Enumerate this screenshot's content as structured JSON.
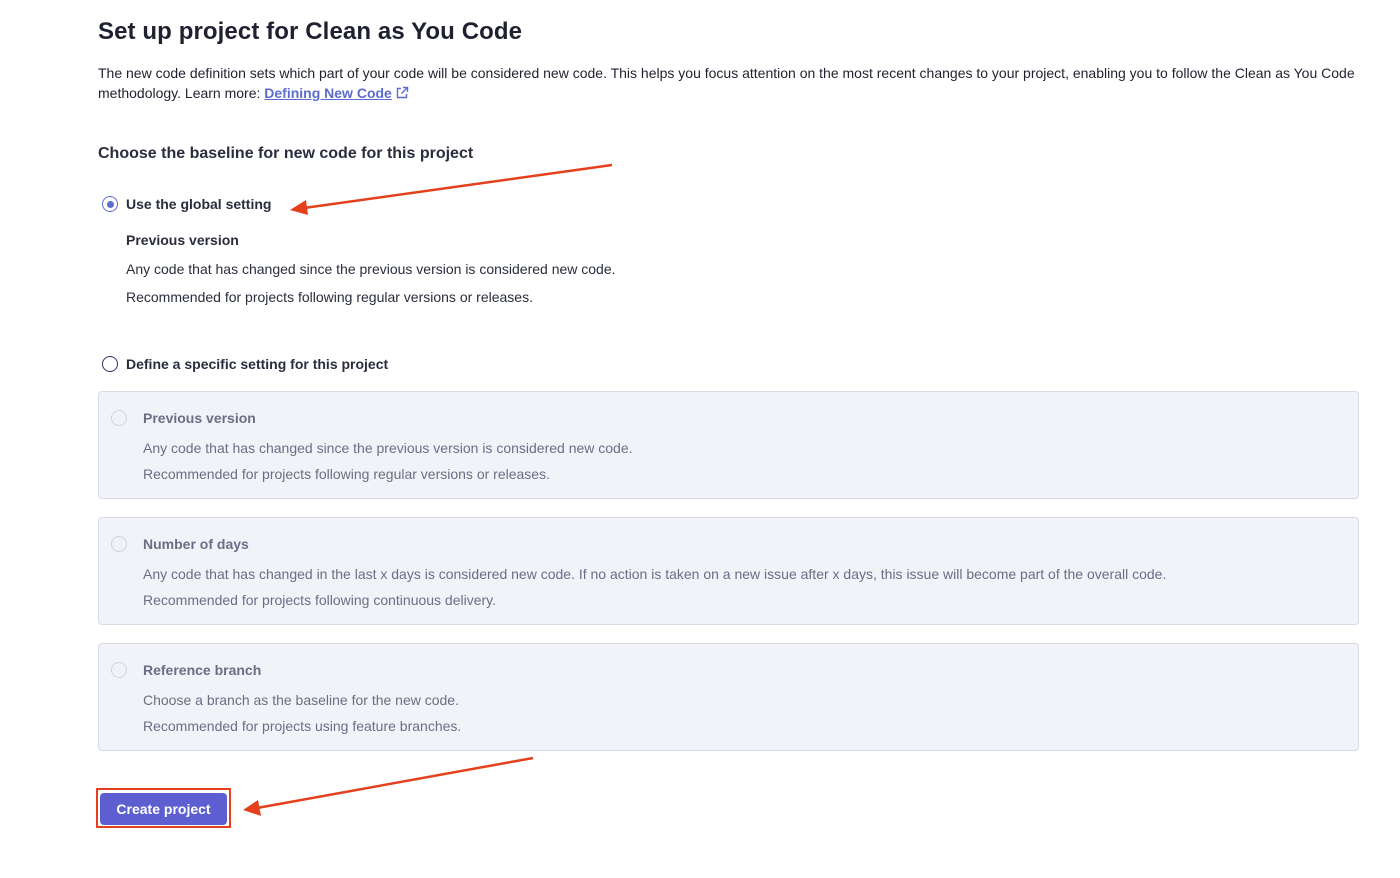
{
  "page": {
    "title": "Set up project for Clean as You Code",
    "intro_text": "The new code definition sets which part of your code will be considered new code. This helps you focus attention on the most recent changes to your project, enabling you to follow the Clean as You Code methodology. Learn more:",
    "learn_more_link": "Defining New Code"
  },
  "baseline": {
    "section_title": "Choose the baseline for new code for this project",
    "global_option": {
      "label": "Use the global setting",
      "selected": true,
      "detail_title": "Previous version",
      "detail_description": "Any code that has changed since the previous version is considered new code.",
      "detail_recommendation": "Recommended for projects following regular versions or releases."
    },
    "specific_option": {
      "label": "Define a specific setting for this project",
      "selected": false,
      "cards": [
        {
          "title": "Previous version",
          "description": "Any code that has changed since the previous version is considered new code.",
          "recommendation": "Recommended for projects following regular versions or releases."
        },
        {
          "title": "Number of days",
          "description": "Any code that has changed in the last x days is considered new code. If no action is taken on a new issue after x days, this issue will become part of the overall code.",
          "recommendation": "Recommended for projects following continuous delivery."
        },
        {
          "title": "Reference branch",
          "description": "Choose a branch as the baseline for the new code.",
          "recommendation": "Recommended for projects using feature branches."
        }
      ]
    }
  },
  "actions": {
    "create_button": "Create project"
  },
  "colors": {
    "accent": "#5d6cd0",
    "button": "#5d5fd0",
    "annotation": "#e4401b",
    "card_bg": "#f2f3f9"
  },
  "icons": {
    "link_icon": "external-link-icon",
    "annotation_icon": "arrow-icon"
  }
}
